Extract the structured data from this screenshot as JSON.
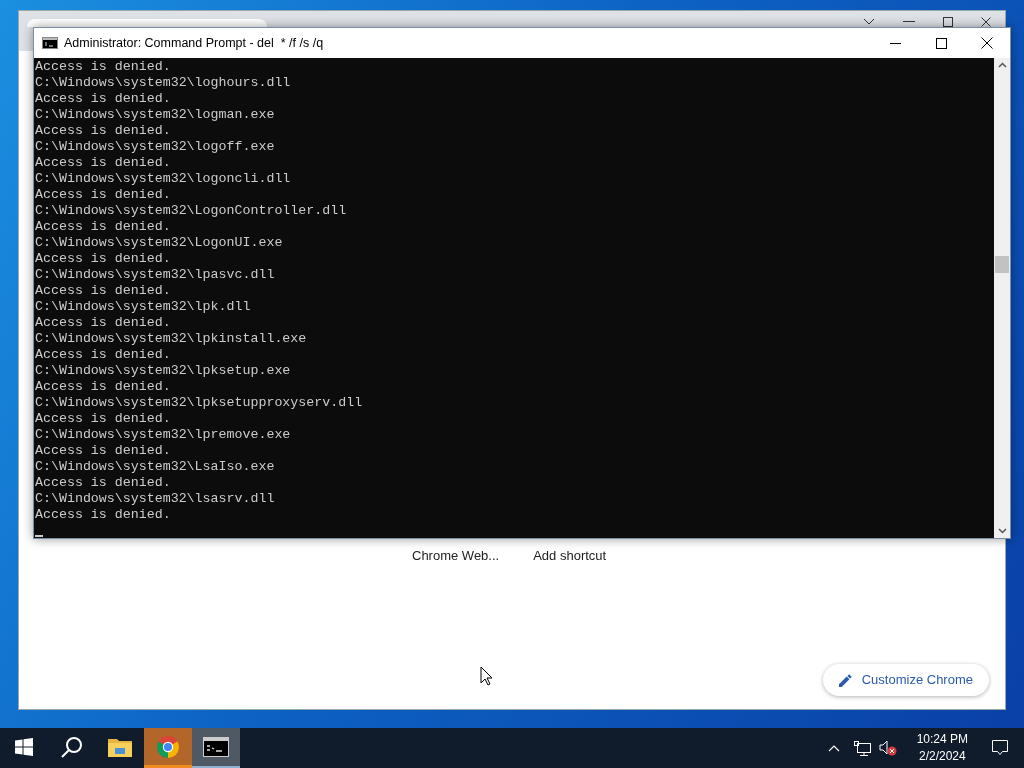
{
  "browser_window": {
    "shortcuts": [
      "Chrome Web...",
      "Add shortcut"
    ],
    "customize_button": "Customize Chrome"
  },
  "console_window": {
    "title": "Administrator: Command Prompt - del  * /f /s /q",
    "lines": [
      "Access is denied.",
      "C:\\Windows\\system32\\loghours.dll",
      "Access is denied.",
      "C:\\Windows\\system32\\logman.exe",
      "Access is denied.",
      "C:\\Windows\\system32\\logoff.exe",
      "Access is denied.",
      "C:\\Windows\\system32\\logoncli.dll",
      "Access is denied.",
      "C:\\Windows\\system32\\LogonController.dll",
      "Access is denied.",
      "C:\\Windows\\system32\\LogonUI.exe",
      "Access is denied.",
      "C:\\Windows\\system32\\lpasvc.dll",
      "Access is denied.",
      "C:\\Windows\\system32\\lpk.dll",
      "Access is denied.",
      "C:\\Windows\\system32\\lpkinstall.exe",
      "Access is denied.",
      "C:\\Windows\\system32\\lpksetup.exe",
      "Access is denied.",
      "C:\\Windows\\system32\\lpksetupproxyserv.dll",
      "Access is denied.",
      "C:\\Windows\\system32\\lpremove.exe",
      "Access is denied.",
      "C:\\Windows\\system32\\LsaIso.exe",
      "Access is denied.",
      "C:\\Windows\\system32\\lsasrv.dll",
      "Access is denied."
    ]
  },
  "taskbar": {
    "items": [
      {
        "kind": "start",
        "selected": false,
        "attention": false
      },
      {
        "kind": "search",
        "selected": false,
        "attention": false
      },
      {
        "kind": "explorer",
        "selected": false,
        "attention": false
      },
      {
        "kind": "chrome",
        "selected": false,
        "attention": true
      },
      {
        "kind": "console",
        "selected": true,
        "attention": false
      }
    ],
    "tray": {
      "sound_muted": true,
      "time": "10:24 PM",
      "date": "2/2/2024"
    }
  }
}
